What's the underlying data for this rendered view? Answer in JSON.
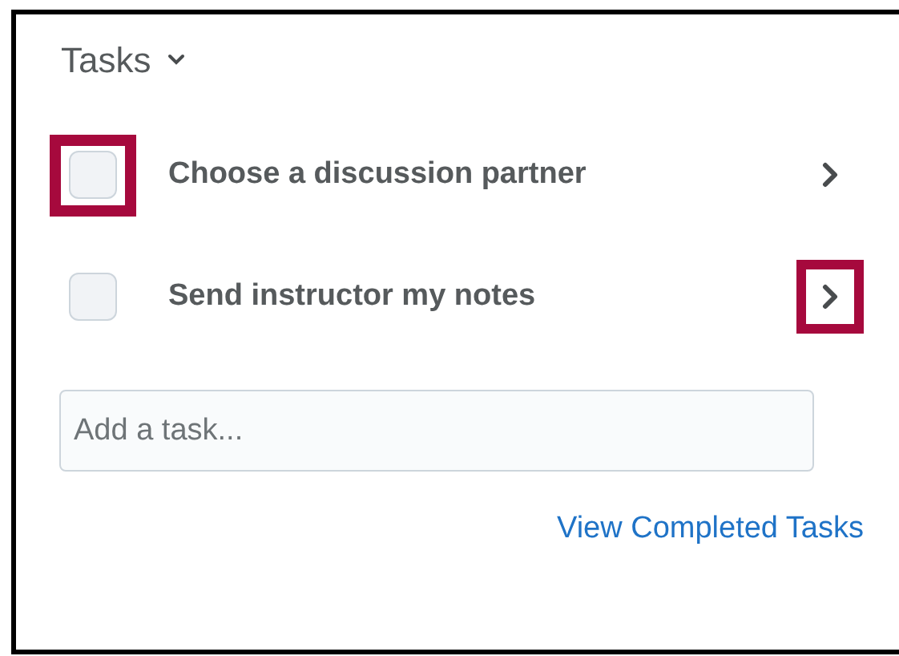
{
  "widget": {
    "title": "Tasks"
  },
  "tasks": [
    {
      "label": "Choose a discussion partner",
      "checked": false,
      "checkbox_highlighted": true,
      "arrow_highlighted": false
    },
    {
      "label": "Send instructor my notes",
      "checked": false,
      "checkbox_highlighted": false,
      "arrow_highlighted": true
    }
  ],
  "add_task": {
    "placeholder": "Add a task..."
  },
  "link": "View Completed Tasks"
}
